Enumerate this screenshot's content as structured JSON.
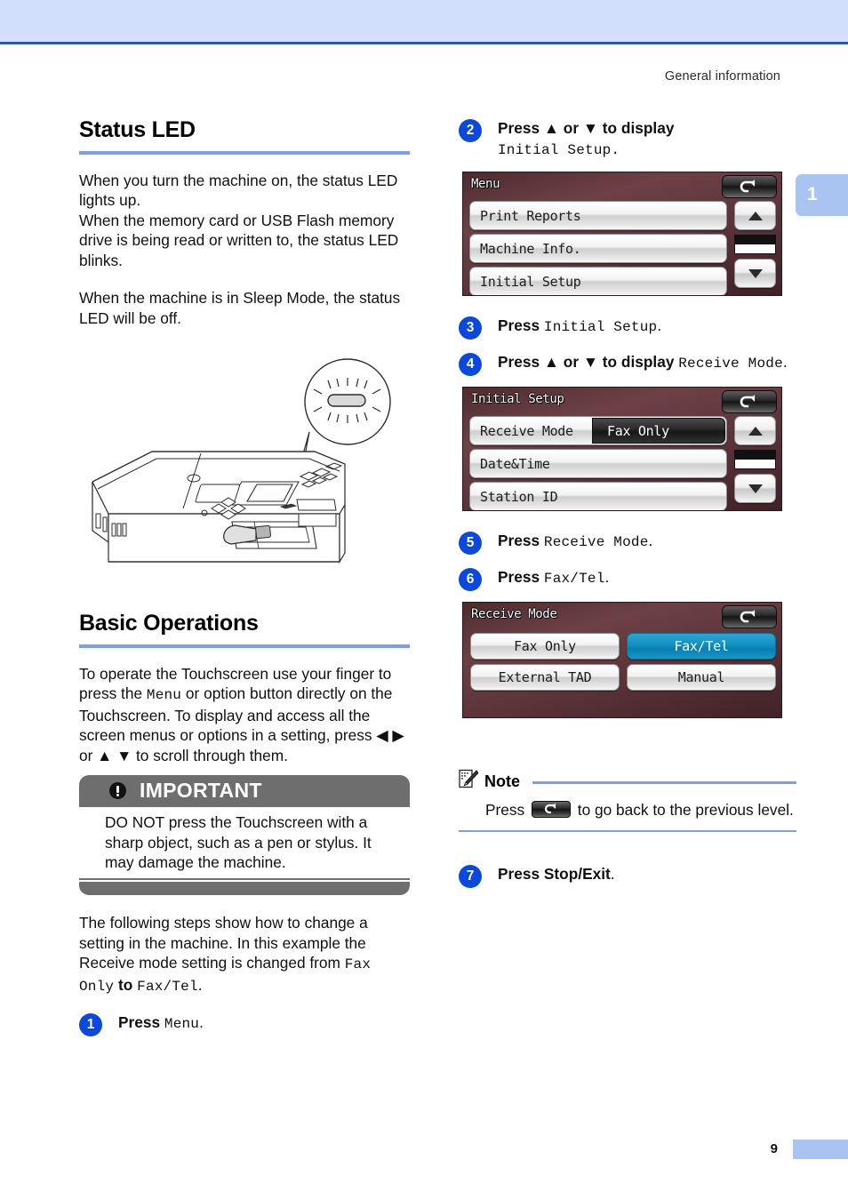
{
  "header": {
    "running_head": "General information",
    "chapter_tab": "1"
  },
  "footer": {
    "page_number": "9"
  },
  "left_column": {
    "section1": {
      "heading": "Status LED",
      "paragraphs": [
        "When you turn the machine on, the status LED lights up.",
        "When the memory card or USB Flash memory drive is being read or written to, the status LED blinks.",
        "When the machine is in Sleep Mode, the status LED will be off."
      ]
    },
    "section2": {
      "heading": "Basic Operations",
      "intro_part1": "To operate the Touchscreen use your finger to press the ",
      "intro_menu": "Menu",
      "intro_part2": " or option button directly on the Touchscreen. To display and access all the screen menus or options in a setting, press ◀ ▶ or ▲ ▼ to scroll through them.",
      "important": {
        "title": "IMPORTANT",
        "body": "DO NOT press the Touchscreen with a sharp object, such as a pen or stylus. It may damage the machine."
      },
      "after_important_part1": "The following steps show how to change a setting in the machine. In this example the Receive mode setting is changed from ",
      "after_important_mono1": "Fax Only",
      "after_important_mid": " to ",
      "after_important_mono2": "Fax/Tel",
      "after_important_end": ".",
      "step1": {
        "number": "1",
        "press_label": "Press ",
        "target": "Menu",
        "period": "."
      }
    }
  },
  "right_column": {
    "step2": {
      "number": "2",
      "line1": "Press ▲ or ▼ to display",
      "line2": "Initial Setup."
    },
    "screen_menu": {
      "title": "Menu",
      "back_icon": "back-arrow-icon",
      "rows": [
        {
          "label": "Print Reports"
        },
        {
          "label": "Machine Info."
        },
        {
          "label": "Initial Setup"
        }
      ],
      "up_icon": "triangle-up-icon",
      "down_icon": "triangle-down-icon"
    },
    "step3": {
      "number": "3",
      "press_label": "Press ",
      "target": "Initial Setup",
      "period": "."
    },
    "step4": {
      "number": "4",
      "press_label": "Press ▲ or ▼ to display ",
      "target": "Receive Mode",
      "period": "."
    },
    "screen_initial_setup": {
      "title": "Initial Setup",
      "back_icon": "back-arrow-icon",
      "rows": [
        {
          "label": "Receive Mode",
          "value": "Fax Only"
        },
        {
          "label": "Date&Time",
          "value": ""
        },
        {
          "label": "Station ID",
          "value": ""
        }
      ],
      "up_icon": "triangle-up-icon",
      "down_icon": "triangle-down-icon"
    },
    "step5": {
      "number": "5",
      "press_label": "Press ",
      "target": "Receive Mode",
      "period": "."
    },
    "step6": {
      "number": "6",
      "press_label": "Press ",
      "target": "Fax/Tel",
      "period": "."
    },
    "screen_receive_mode": {
      "title": "Receive Mode",
      "back_icon": "back-arrow-icon",
      "options": [
        {
          "label": "Fax Only",
          "selected": false
        },
        {
          "label": "Fax/Tel",
          "selected": true
        },
        {
          "label": "External TAD",
          "selected": false
        },
        {
          "label": "Manual",
          "selected": false
        }
      ]
    },
    "note": {
      "icon": "note-pencil-icon",
      "title": "Note",
      "text_before": "Press ",
      "inline_icon": "back-arrow-key-icon",
      "text_after": " to go back to the previous level."
    },
    "step7": {
      "number": "7",
      "press_label": "Press ",
      "target": "Stop/Exit",
      "period": "."
    }
  },
  "illustration": {
    "name": "printer-with-status-led-callout"
  },
  "colors": {
    "band": "#d2dffc",
    "rule": "#0d5bf0",
    "heading_rule": "#7b9fe8",
    "step_circle": "#0b49dd",
    "important_gray": "#6e6e6e",
    "lcd_maroon": "#5a3238",
    "selected_cyan": "#128ec0"
  }
}
